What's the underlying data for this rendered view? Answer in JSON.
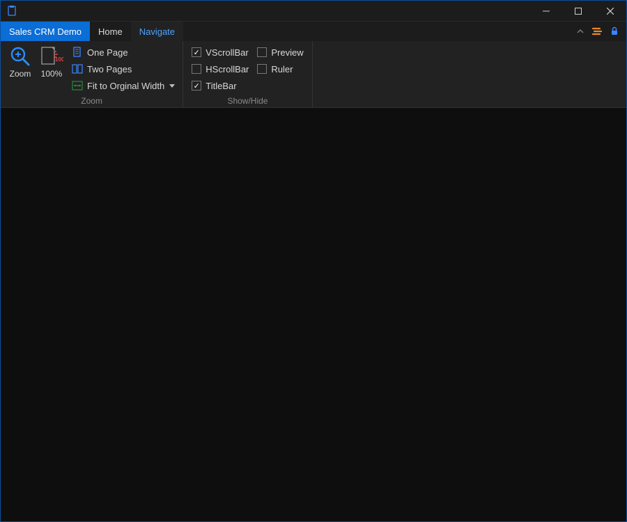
{
  "titlebar": {},
  "tabs": {
    "app": "Sales CRM Demo",
    "home": "Home",
    "navigate": "Navigate"
  },
  "ribbon": {
    "zoom": {
      "group_label": "Zoom",
      "zoom_btn": "Zoom",
      "zoom_100": "100%",
      "one_page": "One Page",
      "two_pages": "Two Pages",
      "fit_width": "Fit to Orginal Width"
    },
    "showhide": {
      "group_label": "Show/Hide",
      "vscroll": "VScrollBar",
      "hscroll": "HScrollBar",
      "titlebar": "TitleBar",
      "preview": "Preview",
      "ruler": "Ruler"
    }
  },
  "checks": {
    "vscroll": true,
    "hscroll": false,
    "titlebar": true,
    "preview": false,
    "ruler": false
  }
}
